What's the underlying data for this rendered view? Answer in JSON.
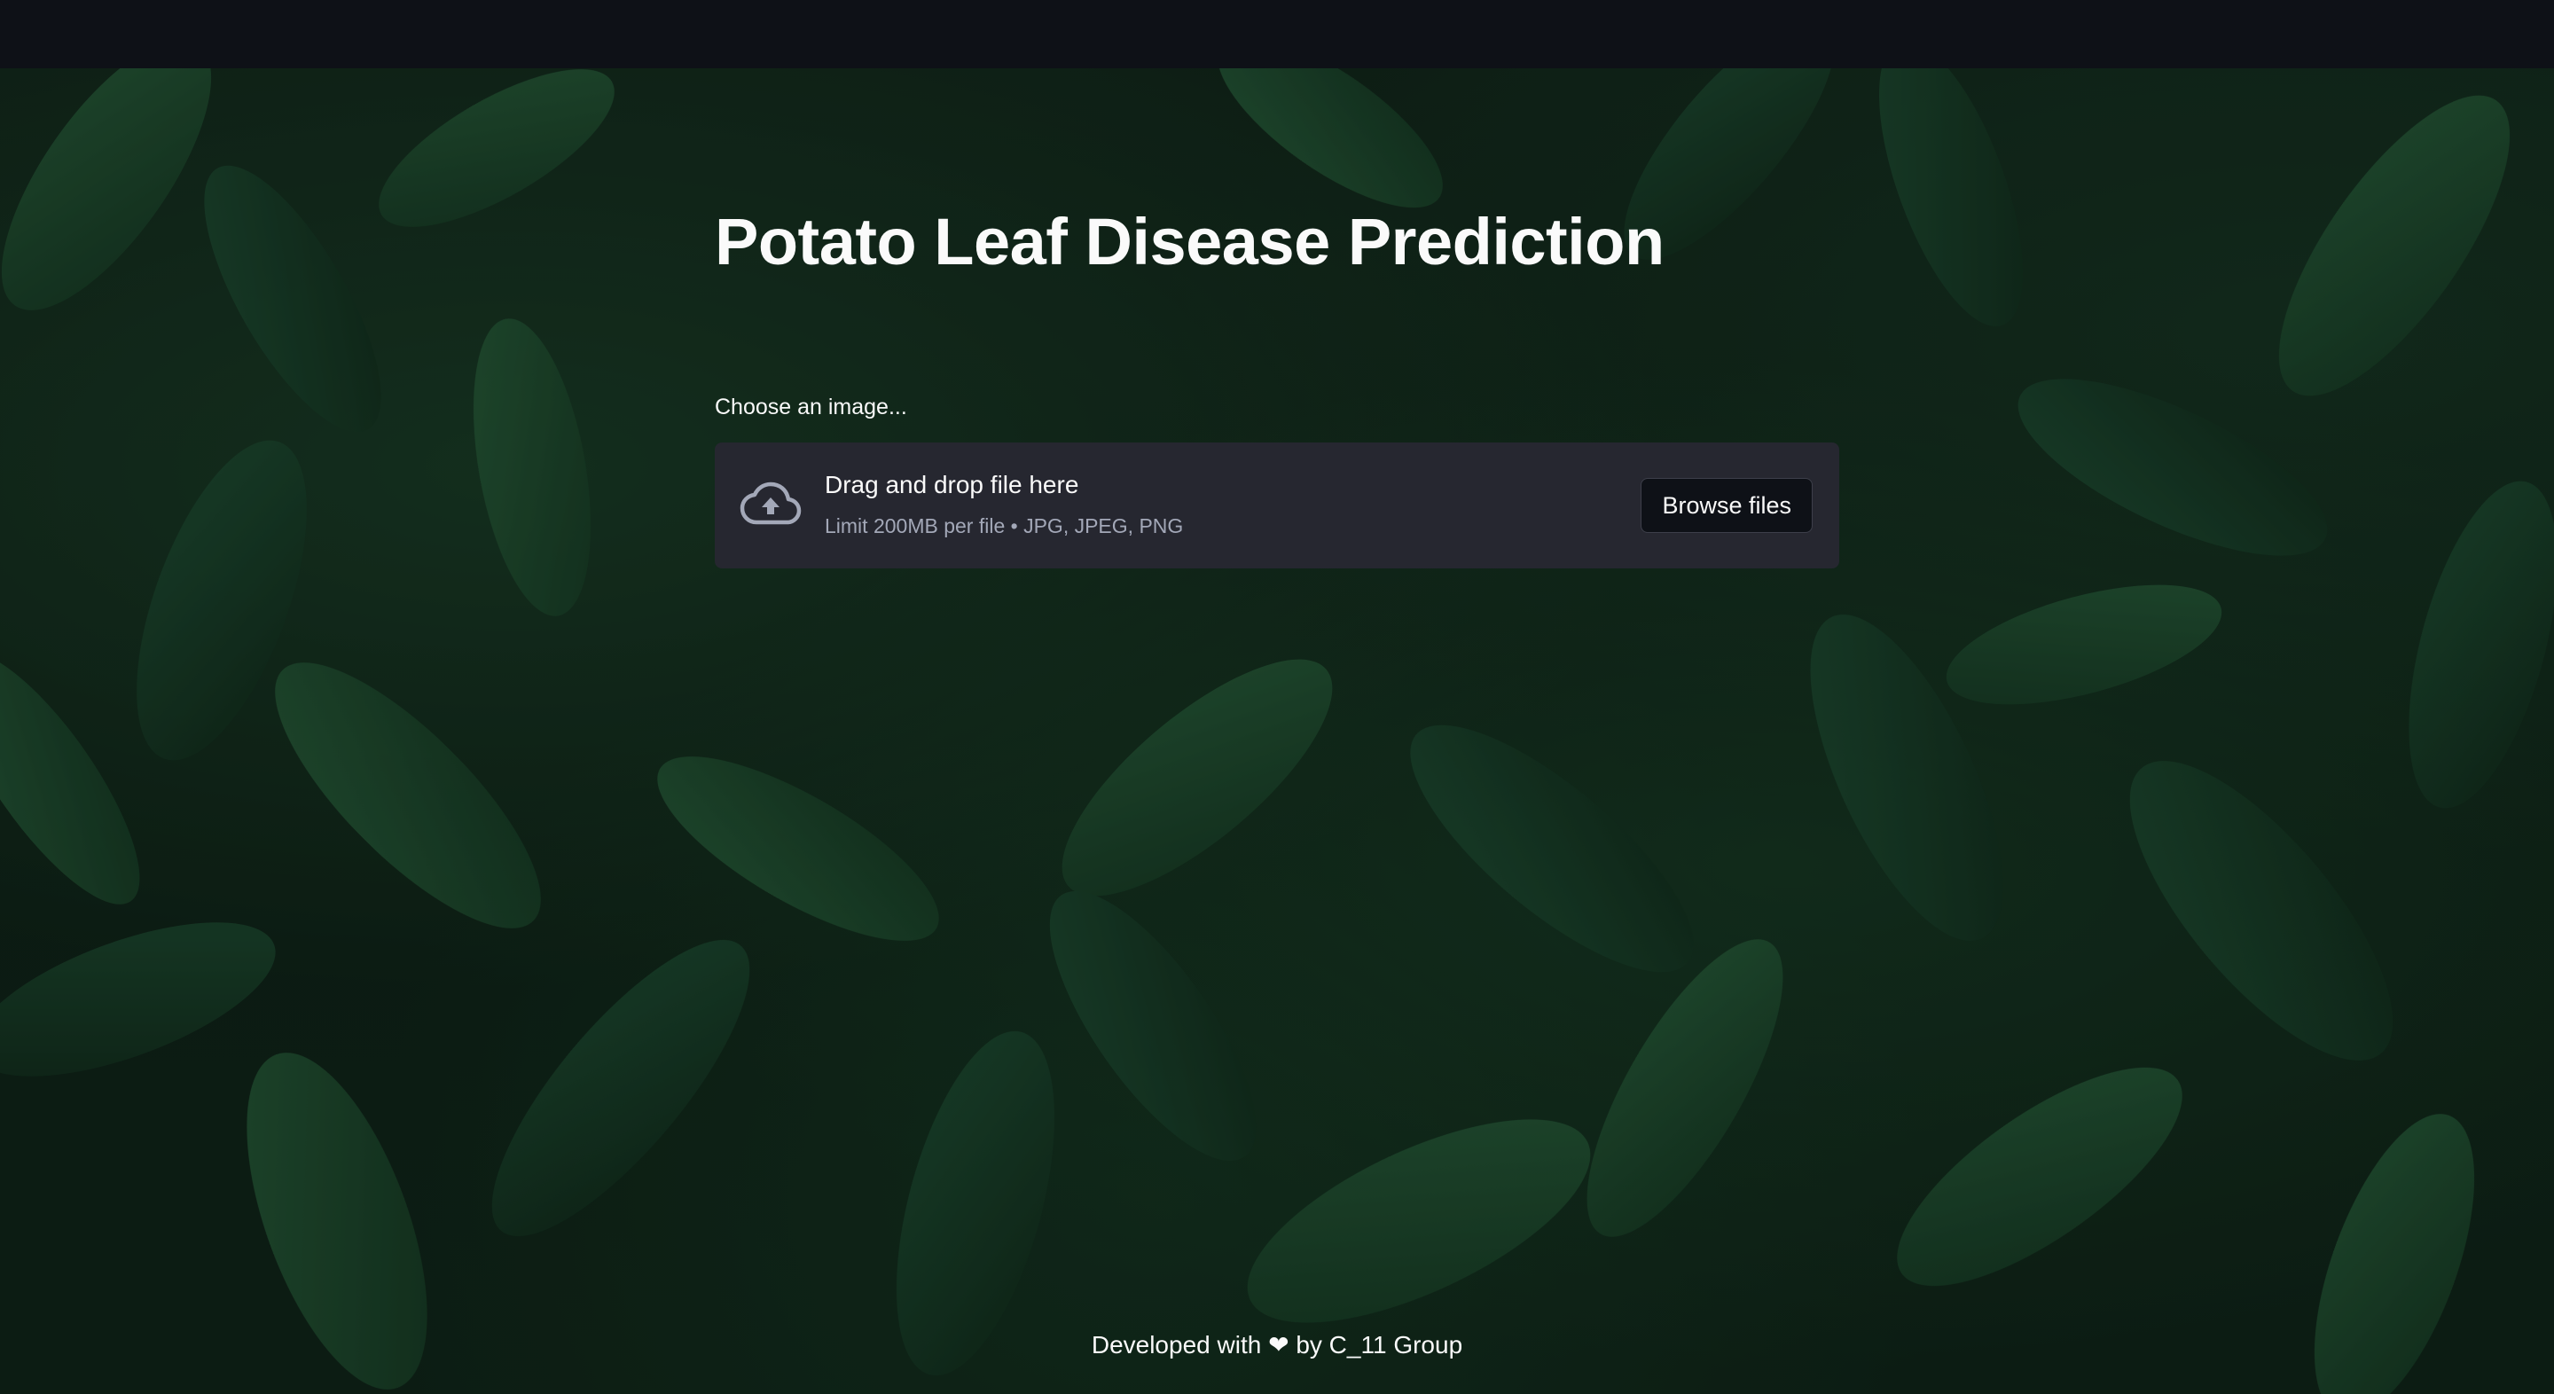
{
  "page": {
    "title": "Potato Leaf Disease Prediction"
  },
  "uploader": {
    "label": "Choose an image...",
    "dropzone_title": "Drag and drop file here",
    "limit_text": "Limit 200MB per file • JPG, JPEG, PNG",
    "browse_label": "Browse files",
    "icon": "cloud-upload-icon"
  },
  "footer": {
    "prefix": "Developed with",
    "heart": "❤",
    "suffix": "by C_11 Group"
  },
  "colors": {
    "header_bg": "#0e1117",
    "dropzone_bg": "#262730",
    "text": "#fafafa",
    "muted_text": "#a3a8b8"
  }
}
